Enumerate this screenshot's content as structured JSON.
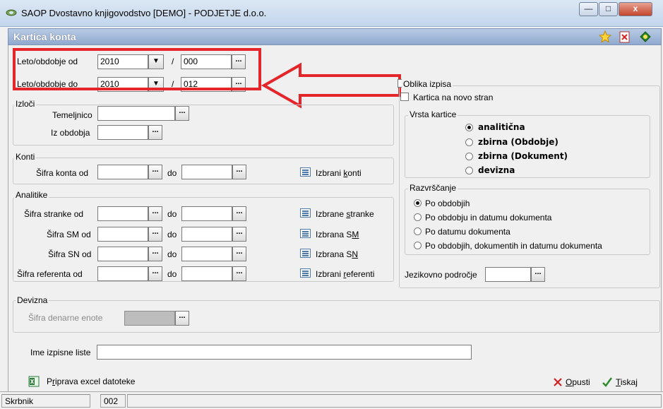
{
  "window": {
    "title": "SAOP  Dvostavno knjigovodstvo  [DEMO] - PODJETJE d.o.o.",
    "minimize": "—",
    "maximize": "□",
    "close": "x"
  },
  "form": {
    "title": "Kartica konta",
    "header_icons": [
      "star-icon",
      "pdf-icon",
      "help-icon"
    ]
  },
  "period": {
    "from_label": "Leto/obdobje od",
    "from_year": "2010",
    "from_period": "000",
    "to_label": "Leto/obdobje do",
    "to_year": "2010",
    "to_period": "012",
    "separator": "/"
  },
  "izloci": {
    "title": "Izloči",
    "temeljnico_label": "Temeljnico",
    "temeljnico_value": "",
    "obdobja_label": "Iz obdobja",
    "obdobja_value": ""
  },
  "konti": {
    "title": "Konti",
    "from_label": "Šifra konta od",
    "to_label": "do",
    "from_value": "",
    "to_value": "",
    "pick_label": "Izbrani konti",
    "pick_underline": "k"
  },
  "analitike": {
    "title": "Analitike",
    "rows": [
      {
        "label": "Šifra stranke od",
        "to": "do",
        "pick": "Izbrane stranke"
      },
      {
        "label": "Šifra SM od",
        "to": "do",
        "pick": "Izbrana SM"
      },
      {
        "label": "Šifra SN od",
        "to": "do",
        "pick": "Izbrana SN"
      },
      {
        "label": "Šifra referenta od",
        "to": "do",
        "pick": "Izbrani referenti"
      }
    ]
  },
  "devizna": {
    "title": "Devizna",
    "label": "Šifra denarne enote",
    "value": ""
  },
  "ime_liste": {
    "label": "Ime izpisne liste",
    "value": ""
  },
  "oblika": {
    "title": "Oblika izpisa",
    "new_page_label": "Kartica na novo stran",
    "vrsta": {
      "title": "Vrsta kartice",
      "options": [
        "analitična",
        "zbirna (Obdobje)",
        "zbirna (Dokument)",
        "devizna"
      ],
      "selected": 0
    },
    "razvrscanje": {
      "title": "Razvrščanje",
      "options": [
        "Po obdobjih",
        "Po obdobju in datumu dokumenta",
        "Po datumu dokumenta",
        "Po obdobjih, dokumentih in datumu dokumenta"
      ],
      "selected": 0
    },
    "jezik_label": "Jezikovno področje",
    "jezik_value": ""
  },
  "footer": {
    "excel_label": "Priprava excel datoteke",
    "cancel_label": "Opusti",
    "print_label": "Tiskaj"
  },
  "status": {
    "user": "Skrbnik",
    "code": "002"
  },
  "dots": "...",
  "arrow": "▼",
  "colors": {
    "annotation": "#e4262a",
    "header": "#8fa9cf"
  }
}
